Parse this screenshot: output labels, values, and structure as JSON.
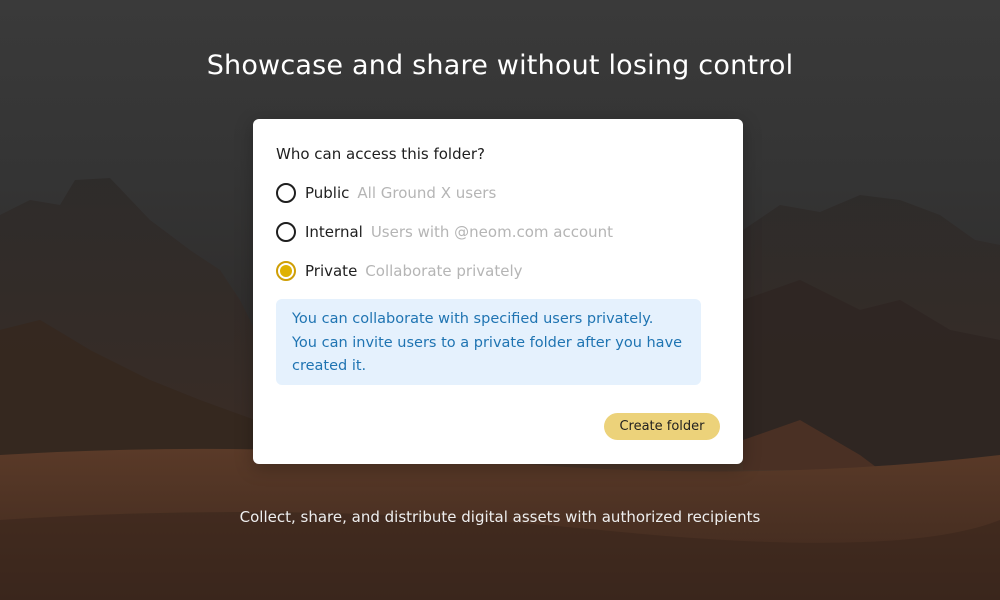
{
  "header": {
    "title": "Showcase and share without losing control"
  },
  "dialog": {
    "question": "Who can access this folder?",
    "options": [
      {
        "label": "Public",
        "description": "All Ground X users",
        "selected": false
      },
      {
        "label": "Internal",
        "description": "Users with @neom.com account",
        "selected": false
      },
      {
        "label": "Private",
        "description": "Collaborate privately",
        "selected": true
      }
    ],
    "info_lines": [
      "You can collaborate with specified users privately.",
      "You can invite users to a private folder after you have",
      "created it."
    ],
    "create_button_label": "Create folder"
  },
  "footer": {
    "tagline": "Collect, share, and distribute digital assets with authorized recipients"
  },
  "colors": {
    "accent": "#dfb100",
    "button_bg": "#ecd27a",
    "info_bg": "#e5f1fd",
    "info_text": "#1f74b2"
  }
}
